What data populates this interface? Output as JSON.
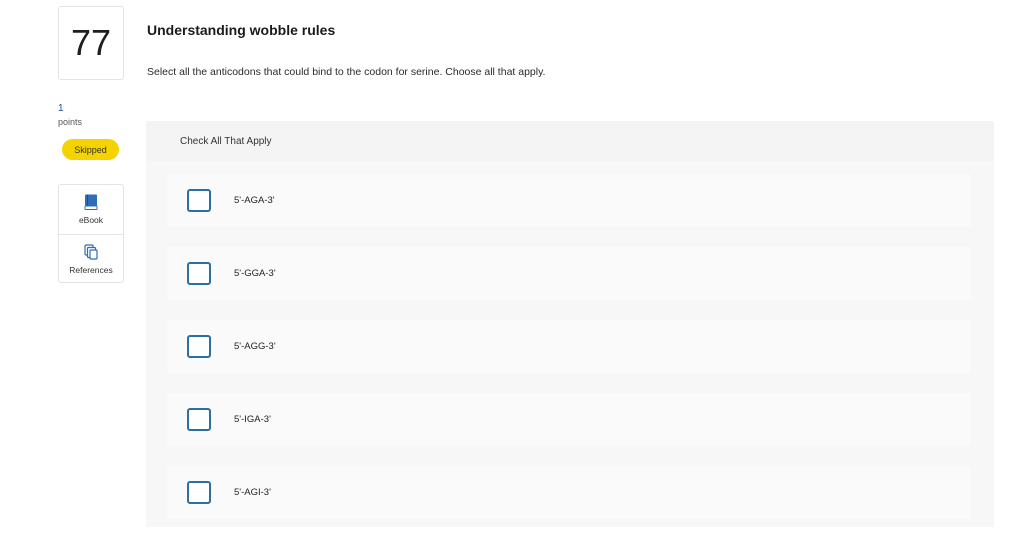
{
  "question": {
    "number": "77",
    "points_value": "1",
    "points_label": "points",
    "status": "Skipped",
    "title": "Understanding wobble rules",
    "prompt": "Select all the anticodons that could bind to the codon for serine. Choose all that apply."
  },
  "tools": [
    {
      "label": "eBook",
      "icon": "book-icon"
    },
    {
      "label": "References",
      "icon": "references-icon"
    }
  ],
  "answer": {
    "instruction": "Check All That Apply",
    "options": [
      {
        "label": "5'-AGA-3'",
        "checked": false
      },
      {
        "label": "5'-GGA-3'",
        "checked": false
      },
      {
        "label": "5'-AGG-3'",
        "checked": false
      },
      {
        "label": "5'-IGA-3'",
        "checked": false
      },
      {
        "label": "5'-AGI-3'",
        "checked": false
      }
    ]
  },
  "colors": {
    "badge": "#f5d300",
    "checkbox_border": "#2b6fa3",
    "panel": "#f4f4f4",
    "book_icon": "#2f6db5"
  }
}
